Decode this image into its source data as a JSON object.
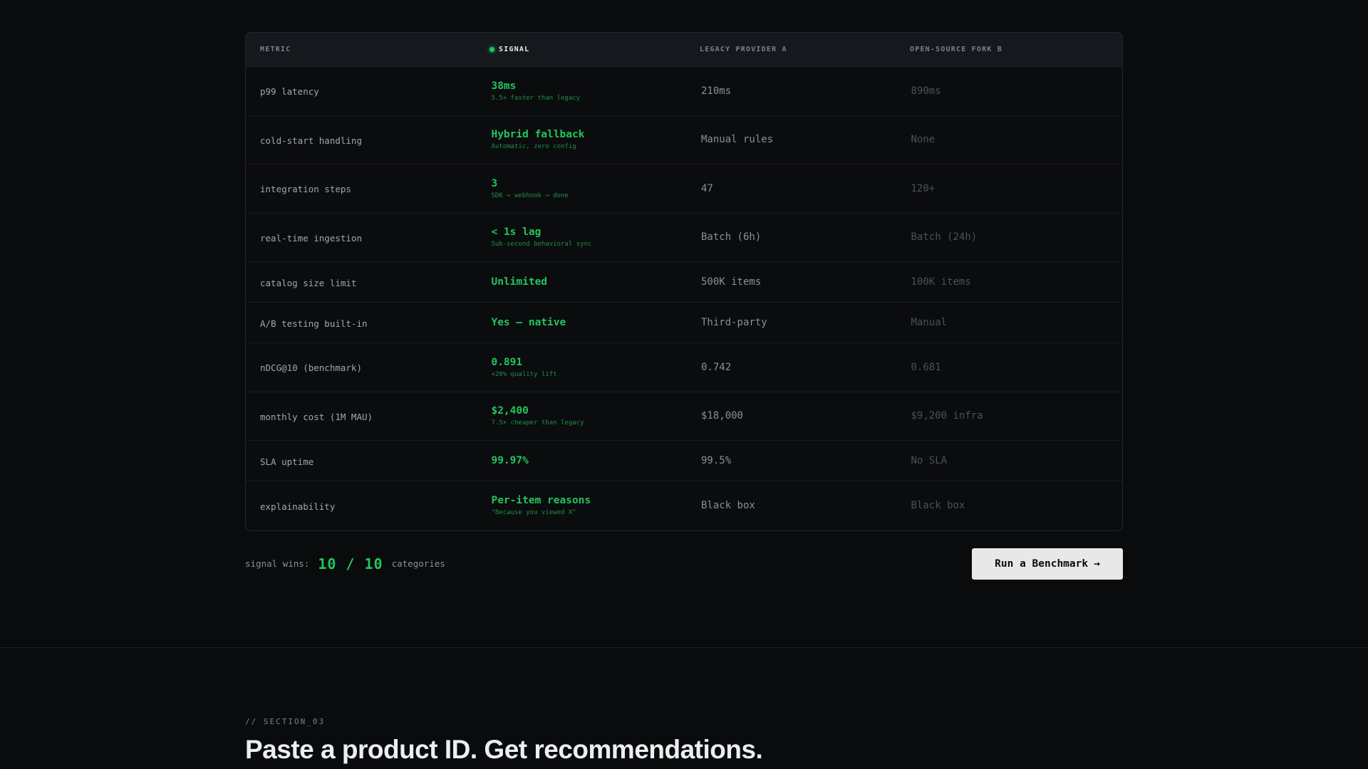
{
  "table": {
    "headers": {
      "metric": "METRIC",
      "signal": "SIGNAL",
      "legacy": "LEGACY PROVIDER A",
      "fork": "OPEN-SOURCE FORK B"
    },
    "rows": [
      {
        "metric": "p99 latency",
        "signal": "38ms",
        "signal_sub": "5.5× faster than legacy",
        "legacy": "210ms",
        "fork": "890ms"
      },
      {
        "metric": "cold-start handling",
        "signal": "Hybrid fallback",
        "signal_sub": "Automatic, zero config",
        "legacy": "Manual rules",
        "fork": "None"
      },
      {
        "metric": "integration steps",
        "signal": "3",
        "signal_sub": "SDK → webhook → done",
        "legacy": "47",
        "fork": "120+"
      },
      {
        "metric": "real-time ingestion",
        "signal": "< 1s lag",
        "signal_sub": "Sub-second behavioral sync",
        "legacy": "Batch (6h)",
        "fork": "Batch (24h)"
      },
      {
        "metric": "catalog size limit",
        "signal": "Unlimited",
        "signal_sub": "",
        "legacy": "500K items",
        "fork": "100K items"
      },
      {
        "metric": "A/B testing built-in",
        "signal": "Yes — native",
        "signal_sub": "",
        "legacy": "Third-party",
        "fork": "Manual"
      },
      {
        "metric": "nDCG@10 (benchmark)",
        "signal": "0.891",
        "signal_sub": "+20% quality lift",
        "legacy": "0.742",
        "fork": "0.681"
      },
      {
        "metric": "monthly cost (1M MAU)",
        "signal": "$2,400",
        "signal_sub": "7.5× cheaper than legacy",
        "legacy": "$18,000",
        "fork": "$9,200 infra"
      },
      {
        "metric": "SLA uptime",
        "signal": "99.97%",
        "signal_sub": "",
        "legacy": "99.5%",
        "fork": "No SLA"
      },
      {
        "metric": "explainability",
        "signal": "Per-item reasons",
        "signal_sub": "\"Because you viewed X\"",
        "legacy": "Black box",
        "fork": "Black box"
      }
    ]
  },
  "summary": {
    "prefix": "signal wins:",
    "count": "10 / 10",
    "suffix": "categories"
  },
  "cta": {
    "label": "Run a Benchmark",
    "arrow": "→"
  },
  "section": {
    "tag": "// SECTION_03",
    "title": "Paste a product ID. Get recommendations."
  },
  "colors": {
    "accent": "#22c55e",
    "background": "#0a0b0d"
  }
}
